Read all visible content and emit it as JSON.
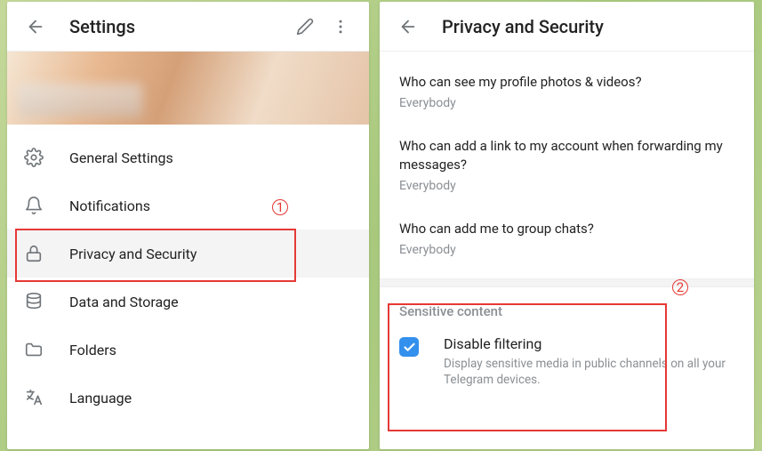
{
  "left": {
    "title": "Settings",
    "menu": [
      {
        "label": "General Settings"
      },
      {
        "label": "Notifications"
      },
      {
        "label": "Privacy and Security"
      },
      {
        "label": "Data and Storage"
      },
      {
        "label": "Folders"
      },
      {
        "label": "Language"
      }
    ]
  },
  "right": {
    "title": "Privacy and Security",
    "privacy": [
      {
        "q": "Who can see my profile photos & videos?",
        "v": "Everybody"
      },
      {
        "q": "Who can add a link to my account when forwarding my messages?",
        "v": "Everybody"
      },
      {
        "q": "Who can add me to group chats?",
        "v": "Everybody"
      }
    ],
    "sensitive": {
      "section": "Sensitive content",
      "title": "Disable filtering",
      "desc": "Display sensitive media in public channels on all your Telegram devices."
    }
  },
  "anno": {
    "one": "1",
    "two": "2"
  }
}
